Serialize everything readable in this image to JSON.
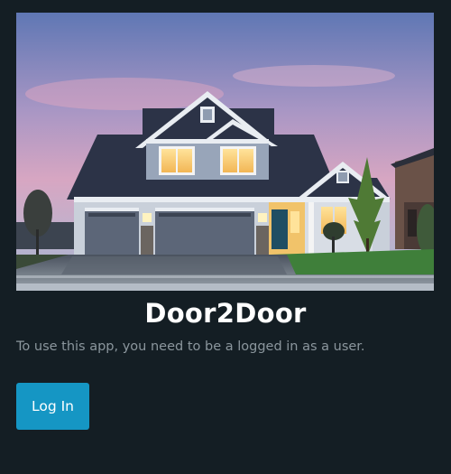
{
  "hero": {
    "image_alt": "Two-story suburban house with a double garage at dusk"
  },
  "app": {
    "title": "Door2Door",
    "message": "To use this app, you need to be a logged in as a user.",
    "login_label": "Log In"
  },
  "colors": {
    "background": "#141e24",
    "title_text": "#ffffff",
    "message_text": "#8b969d",
    "button_background": "#1596c4",
    "button_text": "#ffffff"
  }
}
